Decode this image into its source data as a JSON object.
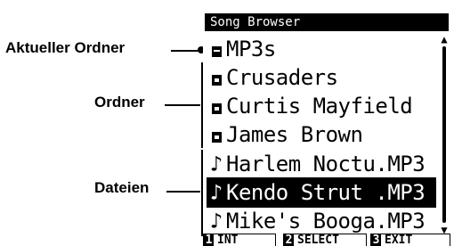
{
  "annotations": {
    "current_folder": "Aktueller Ordner",
    "folders": "Ordner",
    "files": "Dateien"
  },
  "screen": {
    "title": "Song Browser",
    "items": [
      {
        "type": "current-folder",
        "label": "MP3s"
      },
      {
        "type": "folder",
        "label": "Crusaders"
      },
      {
        "type": "folder",
        "label": "Curtis Mayfield"
      },
      {
        "type": "folder",
        "label": "James Brown"
      },
      {
        "type": "file",
        "label": "Harlem Noctu.MP3"
      },
      {
        "type": "file",
        "label": "Kendo Strut .MP3",
        "selected": true
      },
      {
        "type": "file",
        "label": "Mike's Booga.MP3"
      }
    ],
    "icons": {
      "current_folder": "open-folder-icon",
      "folder": "folder-icon",
      "file": "music-note-icon"
    },
    "function_keys": [
      {
        "num": "1",
        "label": "INT"
      },
      {
        "num": "2",
        "label": "SELECT"
      },
      {
        "num": "3",
        "label": "EXIT"
      }
    ]
  }
}
